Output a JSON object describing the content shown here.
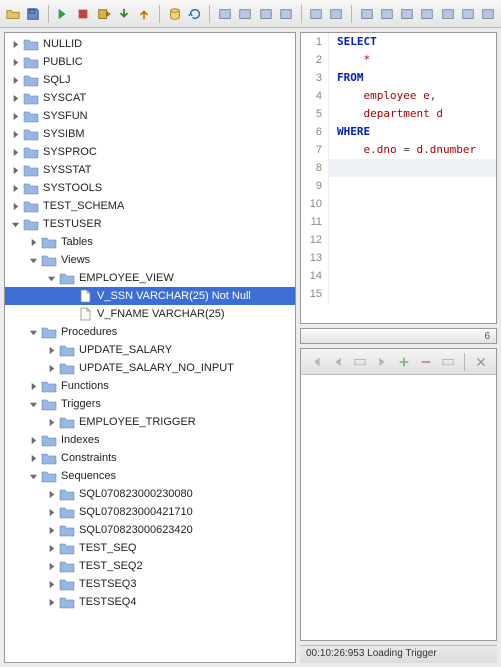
{
  "toolbar_icons": [
    "folder-open-icon",
    "save-icon",
    "sep",
    "run-in-icon",
    "sql-stop-icon",
    "run-script-icon",
    "commit-icon",
    "rollback-icon",
    "sep",
    "db-icon",
    "refresh-icon",
    "sep",
    "edit-icon",
    "copy-sql-icon",
    "new-sql-icon",
    "format-icon",
    "sep",
    "result-grid-icon",
    "result-text-icon",
    "sep",
    "layout1-icon",
    "layout2-icon",
    "layout3-icon",
    "layout4-icon",
    "filter-icon",
    "sort-icon",
    "export-icon"
  ],
  "tree": {
    "items": [
      {
        "d": 1,
        "exp": "closed",
        "icon": "folder",
        "label": "NULLID"
      },
      {
        "d": 1,
        "exp": "closed",
        "icon": "folder",
        "label": "PUBLIC"
      },
      {
        "d": 1,
        "exp": "closed",
        "icon": "folder",
        "label": "SQLJ"
      },
      {
        "d": 1,
        "exp": "closed",
        "icon": "folder",
        "label": "SYSCAT"
      },
      {
        "d": 1,
        "exp": "closed",
        "icon": "folder",
        "label": "SYSFUN"
      },
      {
        "d": 1,
        "exp": "closed",
        "icon": "folder",
        "label": "SYSIBM"
      },
      {
        "d": 1,
        "exp": "closed",
        "icon": "folder",
        "label": "SYSPROC"
      },
      {
        "d": 1,
        "exp": "closed",
        "icon": "folder",
        "label": "SYSSTAT"
      },
      {
        "d": 1,
        "exp": "closed",
        "icon": "folder",
        "label": "SYSTOOLS"
      },
      {
        "d": 1,
        "exp": "closed",
        "icon": "folder",
        "label": "TEST_SCHEMA"
      },
      {
        "d": 1,
        "exp": "open",
        "icon": "folder",
        "label": "TESTUSER"
      },
      {
        "d": 2,
        "exp": "closed",
        "icon": "folder",
        "label": "Tables"
      },
      {
        "d": 2,
        "exp": "open",
        "icon": "folder",
        "label": "Views"
      },
      {
        "d": 3,
        "exp": "open",
        "icon": "folder",
        "label": "EMPLOYEE_VIEW"
      },
      {
        "d": 4,
        "exp": "none",
        "icon": "file",
        "label": "V_SSN VARCHAR(25) Not Null",
        "sel": true
      },
      {
        "d": 4,
        "exp": "none",
        "icon": "file",
        "label": "V_FNAME VARCHAR(25)"
      },
      {
        "d": 2,
        "exp": "open",
        "icon": "folder",
        "label": "Procedures"
      },
      {
        "d": 3,
        "exp": "closed",
        "icon": "folder",
        "label": "UPDATE_SALARY"
      },
      {
        "d": 3,
        "exp": "closed",
        "icon": "folder",
        "label": "UPDATE_SALARY_NO_INPUT"
      },
      {
        "d": 2,
        "exp": "closed",
        "icon": "folder",
        "label": "Functions"
      },
      {
        "d": 2,
        "exp": "open",
        "icon": "folder",
        "label": "Triggers"
      },
      {
        "d": 3,
        "exp": "closed",
        "icon": "folder",
        "label": "EMPLOYEE_TRIGGER"
      },
      {
        "d": 2,
        "exp": "closed",
        "icon": "folder",
        "label": "Indexes"
      },
      {
        "d": 2,
        "exp": "closed",
        "icon": "folder",
        "label": "Constraints"
      },
      {
        "d": 2,
        "exp": "open",
        "icon": "folder",
        "label": "Sequences"
      },
      {
        "d": 3,
        "exp": "closed",
        "icon": "folder",
        "label": "SQL070823000230080"
      },
      {
        "d": 3,
        "exp": "closed",
        "icon": "folder",
        "label": "SQL070823000421710"
      },
      {
        "d": 3,
        "exp": "closed",
        "icon": "folder",
        "label": "SQL070823000623420"
      },
      {
        "d": 3,
        "exp": "closed",
        "icon": "folder",
        "label": "TEST_SEQ"
      },
      {
        "d": 3,
        "exp": "closed",
        "icon": "folder",
        "label": "TEST_SEQ2"
      },
      {
        "d": 3,
        "exp": "closed",
        "icon": "folder",
        "label": "TESTSEQ3"
      },
      {
        "d": 3,
        "exp": "closed",
        "icon": "folder",
        "label": "TESTSEQ4"
      }
    ]
  },
  "sql_lines": [
    {
      "n": 1,
      "tokens": [
        {
          "t": "SELECT",
          "c": "kw"
        }
      ]
    },
    {
      "n": 2,
      "tokens": [
        {
          "t": "    ",
          "c": ""
        },
        {
          "t": "*",
          "c": "ident"
        }
      ]
    },
    {
      "n": 3,
      "tokens": [
        {
          "t": "FROM",
          "c": "kw"
        }
      ]
    },
    {
      "n": 4,
      "tokens": [
        {
          "t": "    ",
          "c": ""
        },
        {
          "t": "employee e",
          "c": "ident"
        },
        {
          "t": ",",
          "c": "punct"
        }
      ]
    },
    {
      "n": 5,
      "tokens": [
        {
          "t": "    ",
          "c": ""
        },
        {
          "t": "department d",
          "c": "ident"
        }
      ]
    },
    {
      "n": 6,
      "tokens": [
        {
          "t": "WHERE",
          "c": "kw"
        }
      ]
    },
    {
      "n": 7,
      "tokens": [
        {
          "t": "    ",
          "c": ""
        },
        {
          "t": "e",
          "c": "ident"
        },
        {
          "t": ".",
          "c": "punct"
        },
        {
          "t": "dno",
          "c": "ident"
        },
        {
          "t": " = ",
          "c": "punct"
        },
        {
          "t": "d",
          "c": "ident"
        },
        {
          "t": ".",
          "c": "punct"
        },
        {
          "t": "dnumber",
          "c": "ident"
        }
      ]
    },
    {
      "n": 8,
      "tokens": [],
      "cursor": true
    },
    {
      "n": 9,
      "tokens": []
    },
    {
      "n": 10,
      "tokens": []
    },
    {
      "n": 11,
      "tokens": []
    },
    {
      "n": 12,
      "tokens": []
    },
    {
      "n": 13,
      "tokens": []
    },
    {
      "n": 14,
      "tokens": []
    },
    {
      "n": 15,
      "tokens": []
    }
  ],
  "hscroll_label": "6",
  "lower_toolbar_icons": [
    "first-icon",
    "prev-icon",
    "row-icon",
    "next-icon",
    "add-row-icon",
    "delete-row-icon",
    "copy-row-icon",
    "sep",
    "cancel-icon"
  ],
  "status_text": "00:10:26:953 Loading Trigger"
}
